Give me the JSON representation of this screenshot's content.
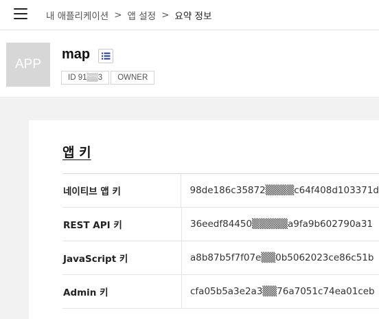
{
  "breadcrumb": {
    "items": [
      "내 애플리케이션",
      "앱 설정",
      "요약 정보"
    ],
    "separator": ">"
  },
  "app": {
    "icon_text": "APP",
    "name": "map",
    "id_badge": "ID 91▒▒3",
    "role_badge": "OWNER"
  },
  "section": {
    "title": "앱 키"
  },
  "keys": [
    {
      "label": "네이티브 앱 키",
      "value": "98de186c35872▒▒▒▒c64f408d103371d"
    },
    {
      "label": "REST API 키",
      "value": "36eedf84450▒▒▒▒▒a9fa9b602790a31"
    },
    {
      "label": "JavaScript 키",
      "value": "a8b87b5f7f07e▒▒0b5062023ce86c51b"
    },
    {
      "label": "Admin 키",
      "value": "cfa05b5a3e2a3▒▒76a7051c74ea01ceb"
    }
  ],
  "colors": {
    "page_gray": "#f2f2f2",
    "icon_gray": "#d7d7d7",
    "border": "#e3e3e3"
  }
}
